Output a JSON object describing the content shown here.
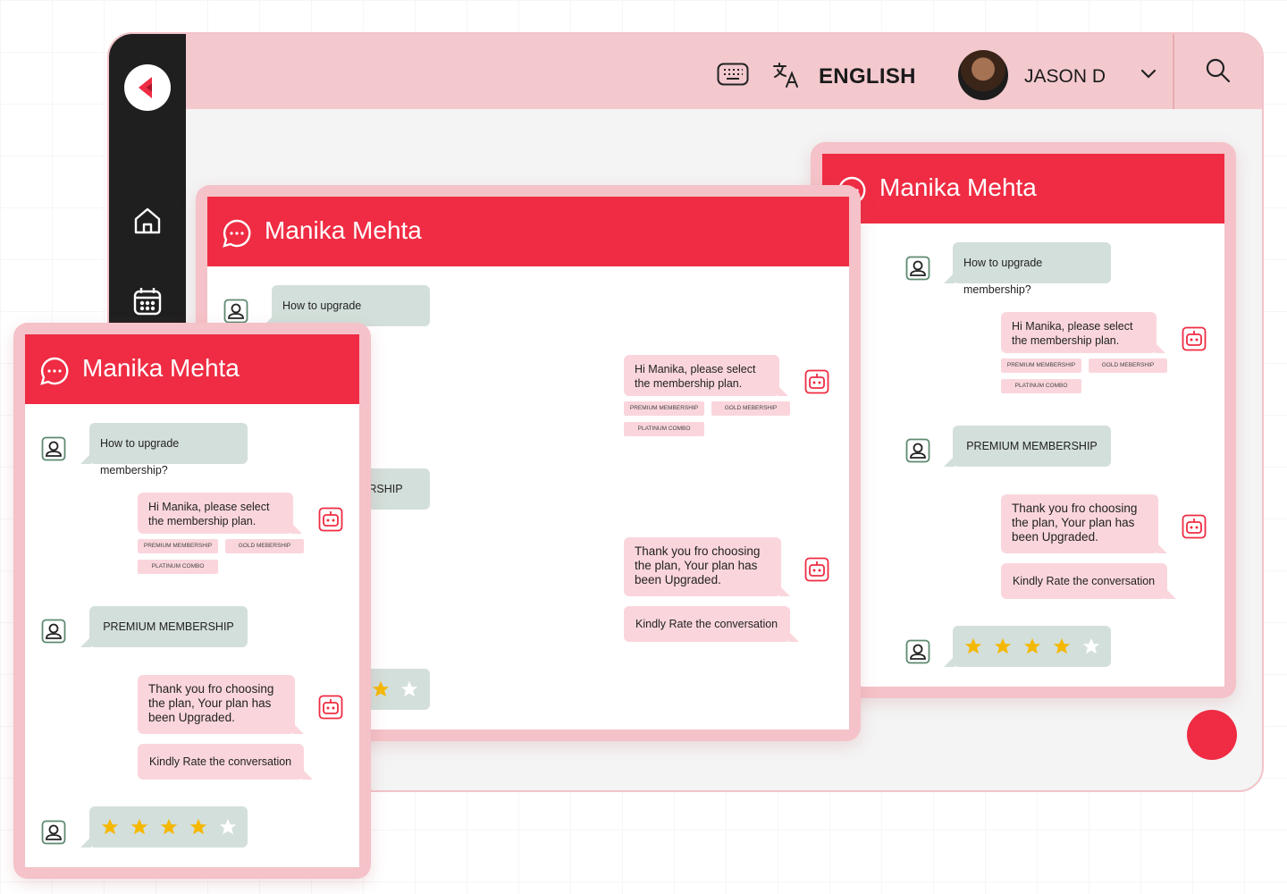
{
  "app": {
    "sidebar": {
      "logo": "brand-logo",
      "icons": [
        "home-icon",
        "calendar-icon"
      ]
    },
    "topbar": {
      "keyboard_icon": "keyboard-icon",
      "translate_icon": "translate-icon",
      "language": "ENGLISH",
      "user_name": "JASON D",
      "search_icon": "search-icon"
    },
    "accent": "#ef2c43"
  },
  "chat": {
    "contact_name": "Manika Mehta",
    "user_question": "How to upgrade membership?",
    "bot_prompt": "Hi Manika, please select the membership plan.",
    "options": [
      "PREMIUM MEMBERSHIP",
      "GOLD MEBERSHIP",
      "PLATINUM COMBO"
    ],
    "user_choice": "PREMIUM MEMBERSHIP",
    "bot_confirm": "Thank you fro choosing the plan, Your plan has been Upgraded.",
    "bot_rate": "Kindly Rate the conversation",
    "partial_choice": "ERSHIP",
    "rating": {
      "value": 4,
      "max": 5
    }
  }
}
